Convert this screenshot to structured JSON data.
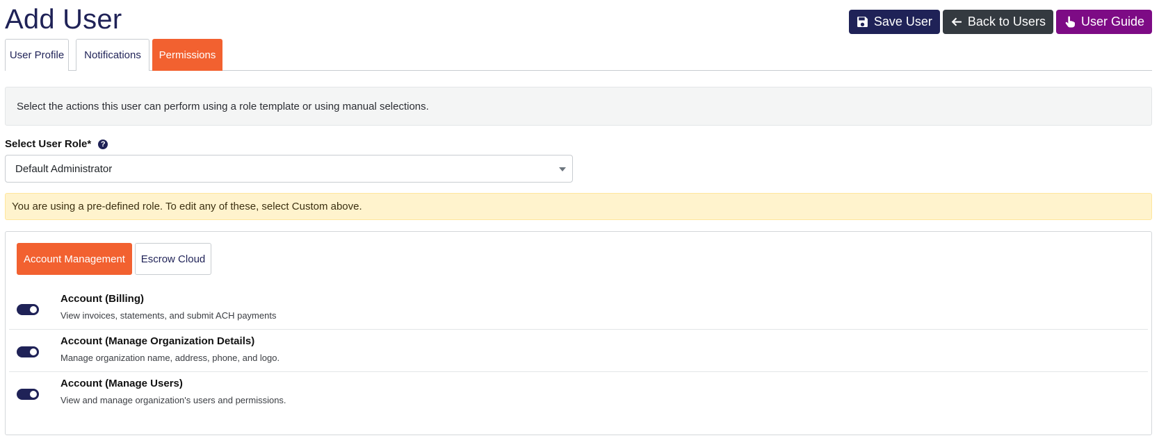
{
  "page": {
    "title": "Add User"
  },
  "actions": {
    "save_label": "Save User",
    "back_label": "Back to Users",
    "guide_label": "User Guide"
  },
  "tabs": [
    {
      "label": "User Profile",
      "active": false
    },
    {
      "label": "Notifications",
      "active": false
    },
    {
      "label": "Permissions",
      "active": true
    }
  ],
  "info": {
    "text": "Select the actions this user can perform using a role template or using manual selections."
  },
  "role": {
    "label": "Select User Role*",
    "help_icon": "question-circle-icon",
    "selected": "Default Administrator"
  },
  "warning": {
    "text": "You are using a pre-defined role. To edit any of these, select Custom above."
  },
  "subtabs": [
    {
      "label": "Account Management",
      "active": true
    },
    {
      "label": "Escrow Cloud",
      "active": false
    }
  ],
  "permissions": [
    {
      "title": "Account (Billing)",
      "description": "View invoices, statements, and submit ACH payments",
      "enabled": true
    },
    {
      "title": "Account (Manage Organization Details)",
      "description": "Manage organization name, address, phone, and logo.",
      "enabled": true
    },
    {
      "title": "Account (Manage Users)",
      "description": "View and manage organization's users and permissions.",
      "enabled": true
    }
  ],
  "colors": {
    "primary": "#1f2257",
    "accent": "#f26130",
    "dark": "#343a40",
    "guide": "#7d0b85",
    "warning_bg": "#fff3cd"
  }
}
